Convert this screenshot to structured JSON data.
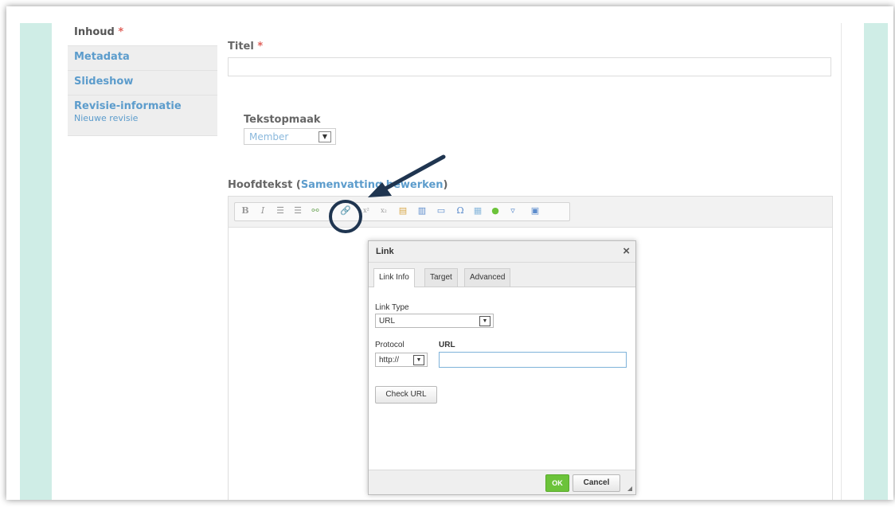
{
  "sidebar": {
    "tabs": [
      {
        "label": "Inhoud",
        "required": "*"
      },
      {
        "label": "Metadata"
      },
      {
        "label": "Slideshow"
      },
      {
        "label": "Revisie-informatie",
        "sub": "Nieuwe revisie"
      }
    ]
  },
  "form": {
    "title_label": "Titel",
    "required_mark": "*",
    "format_label": "Tekstopmaak",
    "format_value": "Member",
    "body_label_prefix": "Hoofdtekst (",
    "body_label_link": "Samenvatting bewerken",
    "body_label_suffix": ")"
  },
  "toolbar": {
    "buttons": [
      {
        "name": "bold-icon",
        "glyph": "B"
      },
      {
        "name": "italic-icon",
        "glyph": "I"
      },
      {
        "name": "bulleted-list-icon",
        "glyph": "☰"
      },
      {
        "name": "numbered-list-icon",
        "glyph": "☰"
      },
      {
        "name": "unlink-icon",
        "glyph": "⚯"
      },
      {
        "name": "link-icon",
        "glyph": "🔗"
      },
      {
        "name": "superscript-icon",
        "glyph": "x²"
      },
      {
        "name": "subscript-icon",
        "glyph": "x₂"
      },
      {
        "name": "paste-text-icon",
        "glyph": "▤"
      },
      {
        "name": "paste-word-icon",
        "glyph": "▥"
      },
      {
        "name": "image-icon",
        "glyph": "▭"
      },
      {
        "name": "special-char-icon",
        "glyph": "Ω"
      },
      {
        "name": "table-icon",
        "glyph": "▦"
      },
      {
        "name": "media-icon",
        "glyph": "●"
      },
      {
        "name": "style-dropdown-icon",
        "glyph": "▿"
      },
      {
        "name": "fullscreen-icon",
        "glyph": "▣"
      }
    ]
  },
  "dialog": {
    "title": "Link",
    "close": "×",
    "tabs": [
      "Link Info",
      "Target",
      "Advanced"
    ],
    "link_type_label": "Link Type",
    "link_type_value": "URL",
    "protocol_label": "Protocol",
    "protocol_value": "http://",
    "url_label": "URL",
    "url_value": "",
    "check_url": "Check URL",
    "ok": "OK",
    "cancel": "Cancel"
  },
  "colors": {
    "accent": "#5c9ccc",
    "required": "#e0605a",
    "band": "#cfede6",
    "ok_green": "#6cc33a",
    "annotation": "#1f3550"
  }
}
